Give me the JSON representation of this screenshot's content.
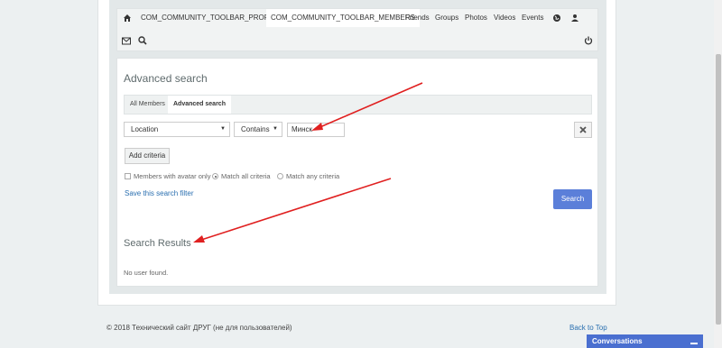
{
  "toolbar": {
    "items": [
      "COM_COMMUNITY_TOOLBAR_PROFILE",
      "COM_COMMUNITY_TOOLBAR_MEMBERS",
      "Friends",
      "Groups",
      "Photos",
      "Videos",
      "Events"
    ],
    "icons": [
      "home-icon",
      "globe-icon",
      "user-add-icon",
      "mail-icon",
      "search-icon",
      "power-icon"
    ]
  },
  "advanced": {
    "heading": "Advanced search",
    "tabs": [
      "All Members",
      "Advanced search"
    ],
    "field_select": "Location",
    "condition_select": "Contains",
    "value_input": "Минск",
    "add_criteria": "Add criteria",
    "options": [
      "Members with avatar only",
      "Match all criteria",
      "Match any criteria"
    ],
    "save_filter": "Save this search filter",
    "search_button": "Search"
  },
  "results": {
    "heading": "Search Results",
    "empty_message": "No user found."
  },
  "footer": {
    "copyright": "© 2018 Технический сайт ДРУГ (не для пользователей)",
    "back_to_top": "Back to Top"
  },
  "chat": {
    "label": "Conversations"
  },
  "colors": {
    "accent": "#5b7fd9",
    "link": "#2a6fb0",
    "chat_bar": "#4a6fd0",
    "annotation_arrow": "#e02020"
  }
}
